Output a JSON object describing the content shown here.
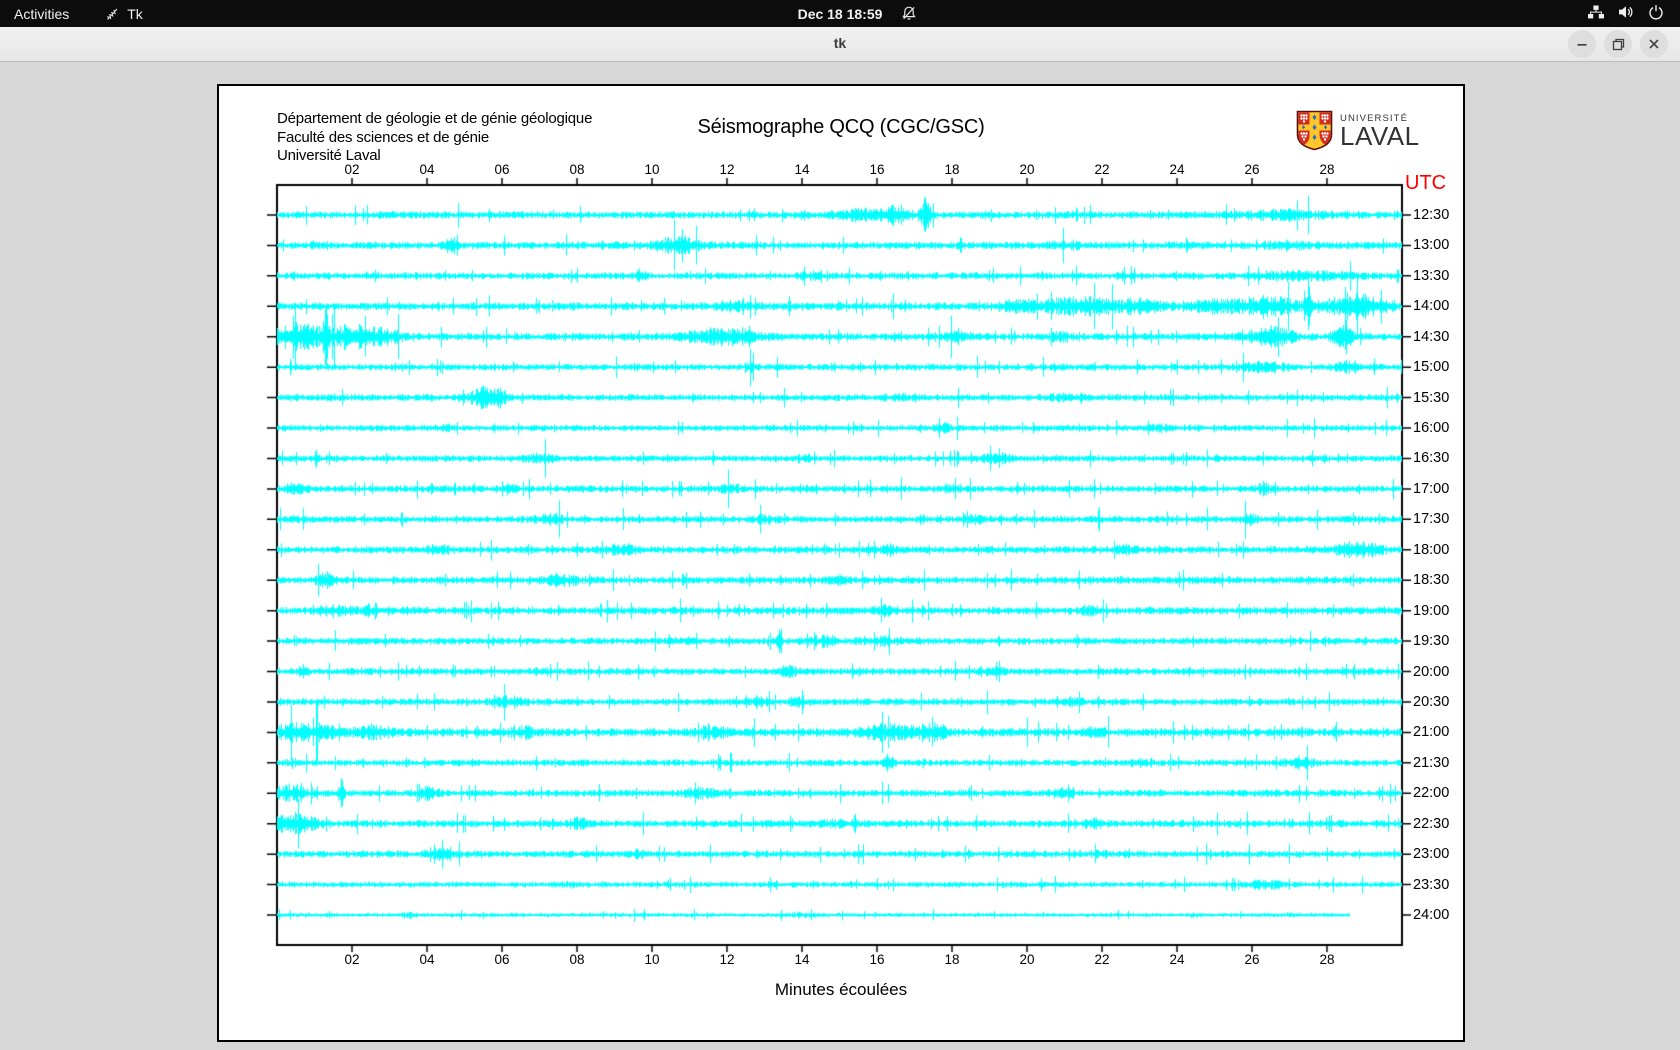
{
  "topbar": {
    "activities": "Activities",
    "app_name": "Tk",
    "clock": "Dec 18 18:59"
  },
  "titlebar": {
    "title": "tk"
  },
  "seismograph": {
    "header_lines": [
      "Département de géologie et de génie géologique",
      "Faculté des sciences et de génie",
      "Université Laval"
    ],
    "title": "Séismographe QCQ (CGC/GSC)",
    "logo_small": "UNIVERSITÉ",
    "logo_large": "LAVAL",
    "utc_label": "UTC",
    "x_axis_title": "Minutes écoulées",
    "colors": {
      "trace": "#00ffff",
      "utc_label": "#ff0000",
      "axis": "#000000",
      "shield_red": "#d52b1e",
      "shield_yellow": "#ffc62c",
      "shield_blue": "#2d69b4"
    },
    "chart_data": {
      "type": "line",
      "xlabel": "Minutes écoulées",
      "x_range_minutes": [
        0,
        30
      ],
      "minute_ticks": [
        "02",
        "04",
        "06",
        "08",
        "10",
        "12",
        "14",
        "16",
        "18",
        "20",
        "22",
        "24",
        "26",
        "28"
      ],
      "rows": [
        {
          "utc": "12:30",
          "base": 3.2,
          "events": [
            [
              15.9,
              0.6,
              5
            ],
            [
              17.3,
              0.09,
              13
            ],
            [
              16.6,
              0.25,
              4
            ],
            [
              26.8,
              0.8,
              2.5
            ]
          ]
        },
        {
          "utc": "13:00",
          "base": 3.3,
          "events": [
            [
              4.6,
              0.12,
              4
            ],
            [
              10.7,
              0.4,
              6
            ],
            [
              21.0,
              0.3,
              2.5
            ],
            [
              27.0,
              0.5,
              2
            ]
          ]
        },
        {
          "utc": "13:30",
          "base": 3.0,
          "events": [
            [
              9.7,
              0.07,
              5
            ],
            [
              14.2,
              0.3,
              2
            ],
            [
              27.3,
              1.0,
              2.5
            ]
          ]
        },
        {
          "utc": "14:00",
          "base": 3.3,
          "events": [
            [
              12.1,
              0.3,
              3
            ],
            [
              20.0,
              0.5,
              4.5
            ],
            [
              21.5,
              0.6,
              6.5
            ],
            [
              23.0,
              0.4,
              5
            ],
            [
              25.0,
              0.4,
              5
            ],
            [
              26.4,
              0.5,
              8
            ],
            [
              27.5,
              0.05,
              27
            ],
            [
              28.8,
              0.5,
              11
            ]
          ]
        },
        {
          "utc": "14:30",
          "base": 3.3,
          "events": [
            [
              0.5,
              0.5,
              11
            ],
            [
              1.3,
              0.05,
              23
            ],
            [
              2.0,
              0.4,
              9
            ],
            [
              2.9,
              0.3,
              5
            ],
            [
              11.6,
              0.5,
              5
            ],
            [
              12.4,
              0.3,
              4
            ],
            [
              18.0,
              0.3,
              2.5
            ],
            [
              20.9,
              0.2,
              3
            ],
            [
              26.5,
              0.4,
              8
            ],
            [
              28.4,
              0.18,
              11
            ]
          ]
        },
        {
          "utc": "15:00",
          "base": 2.8,
          "events": [
            [
              12.6,
              0.1,
              4
            ],
            [
              26.3,
              0.5,
              3
            ],
            [
              28.6,
              0.3,
              4
            ]
          ]
        },
        {
          "utc": "15:30",
          "base": 2.9,
          "events": [
            [
              5.5,
              0.28,
              8
            ],
            [
              5.9,
              0.12,
              5
            ],
            [
              16.5,
              0.3,
              1.5
            ],
            [
              21.0,
              0.3,
              2
            ]
          ]
        },
        {
          "utc": "16:00",
          "base": 2.7,
          "events": [
            [
              4.5,
              0.12,
              2.5
            ],
            [
              17.8,
              0.15,
              2.5
            ],
            [
              23.5,
              0.2,
              2
            ]
          ]
        },
        {
          "utc": "16:30",
          "base": 2.8,
          "events": [
            [
              1.05,
              0.05,
              8
            ],
            [
              7.0,
              0.3,
              2.5
            ],
            [
              14.0,
              0.2,
              2
            ],
            [
              19.2,
              0.3,
              3.5
            ]
          ]
        },
        {
          "utc": "17:00",
          "base": 3.0,
          "events": [
            [
              0.5,
              0.2,
              3.5
            ],
            [
              6.2,
              0.12,
              3.5
            ],
            [
              12.0,
              0.2,
              2.5
            ],
            [
              18.0,
              0.15,
              3.5
            ],
            [
              26.3,
              0.12,
              4.5
            ]
          ]
        },
        {
          "utc": "17:30",
          "base": 3.0,
          "events": [
            [
              7.3,
              0.28,
              3.5
            ],
            [
              13.0,
              0.2,
              2
            ],
            [
              18.6,
              0.2,
              2.5
            ],
            [
              25.9,
              0.15,
              3.5
            ]
          ]
        },
        {
          "utc": "18:00",
          "base": 3.1,
          "events": [
            [
              4.3,
              0.2,
              3.5
            ],
            [
              9.2,
              0.3,
              3.5
            ],
            [
              16.3,
              0.15,
              3.5
            ],
            [
              22.6,
              0.2,
              2.5
            ],
            [
              28.8,
              0.45,
              5.5
            ]
          ]
        },
        {
          "utc": "18:30",
          "base": 3.1,
          "events": [
            [
              1.3,
              0.18,
              4.5
            ],
            [
              7.6,
              0.3,
              4.5
            ],
            [
              14.9,
              0.2,
              2.5
            ],
            [
              24.4,
              0.15,
              2.5
            ]
          ]
        },
        {
          "utc": "19:00",
          "base": 3.3,
          "events": [
            [
              1.5,
              0.3,
              3.5
            ],
            [
              2.6,
              0.2,
              3.5
            ],
            [
              16.2,
              0.2,
              3.5
            ],
            [
              21.6,
              0.2,
              2.5
            ]
          ]
        },
        {
          "utc": "19:30",
          "base": 3.0,
          "events": [
            [
              13.4,
              0.05,
              12
            ],
            [
              14.6,
              0.3,
              3.5
            ],
            [
              16.1,
              0.4,
              2.5
            ]
          ]
        },
        {
          "utc": "20:00",
          "base": 3.0,
          "events": [
            [
              0.7,
              0.1,
              4.5
            ],
            [
              13.6,
              0.15,
              3.5
            ],
            [
              19.1,
              0.2,
              2.5
            ]
          ]
        },
        {
          "utc": "20:30",
          "base": 3.0,
          "events": [
            [
              6.2,
              0.28,
              3.5
            ],
            [
              12.9,
              0.2,
              2.5
            ],
            [
              13.9,
              0.15,
              3.5
            ],
            [
              21.2,
              0.2,
              2.5
            ]
          ]
        },
        {
          "utc": "21:00",
          "base": 3.7,
          "events": [
            [
              0.4,
              0.3,
              6
            ],
            [
              1.2,
              0.25,
              5.5
            ],
            [
              2.6,
              0.4,
              4.5
            ],
            [
              6.6,
              0.3,
              3.5
            ],
            [
              11.6,
              0.3,
              3.5
            ],
            [
              16.3,
              0.5,
              5.5
            ],
            [
              17.4,
              0.3,
              5.5
            ],
            [
              21.8,
              0.18,
              4.5
            ]
          ]
        },
        {
          "utc": "21:30",
          "base": 2.9,
          "events": [
            [
              16.3,
              0.07,
              7.5
            ],
            [
              23.0,
              0.2,
              2
            ],
            [
              27.2,
              0.3,
              3.5
            ]
          ]
        },
        {
          "utc": "22:00",
          "base": 3.1,
          "events": [
            [
              0.35,
              0.28,
              6.5
            ],
            [
              1.7,
              0.06,
              10.5
            ],
            [
              4.0,
              0.18,
              4.5
            ],
            [
              11.3,
              0.28,
              3.5
            ],
            [
              20.9,
              0.2,
              2.5
            ]
          ]
        },
        {
          "utc": "22:30",
          "base": 3.2,
          "events": [
            [
              0.45,
              0.4,
              7.5
            ],
            [
              8.0,
              0.2,
              3.5
            ],
            [
              15.0,
              0.25,
              2
            ],
            [
              21.8,
              0.18,
              3.5
            ]
          ]
        },
        {
          "utc": "23:00",
          "base": 3.0,
          "events": [
            [
              4.4,
              0.22,
              4.5
            ],
            [
              9.6,
              0.2,
              2.5
            ],
            [
              21.9,
              0.12,
              2.5
            ]
          ]
        },
        {
          "utc": "23:30",
          "base": 2.4,
          "events": [
            [
              7.6,
              0.2,
              1.5
            ],
            [
              26.3,
              0.3,
              3.5
            ]
          ]
        },
        {
          "utc": "24:00",
          "base": 1.7,
          "len": 28.6,
          "events": [
            [
              3.5,
              0.12,
              2
            ],
            [
              14.0,
              0.3,
              1.2
            ]
          ]
        }
      ]
    }
  }
}
